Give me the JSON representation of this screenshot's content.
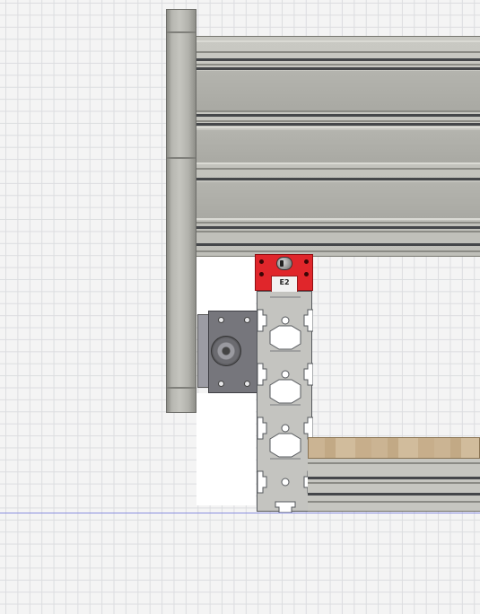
{
  "viewport": {
    "background": "#f4f4f4",
    "grid_color": "#dcdde0",
    "ground_line_color": "#8a8fe0"
  },
  "model": {
    "end_cap": {
      "label": "E2",
      "color": "#e0262b"
    },
    "profile_color": "#c4c4c0",
    "mount_color": "#76767c",
    "wood_color": "#cbb493"
  }
}
